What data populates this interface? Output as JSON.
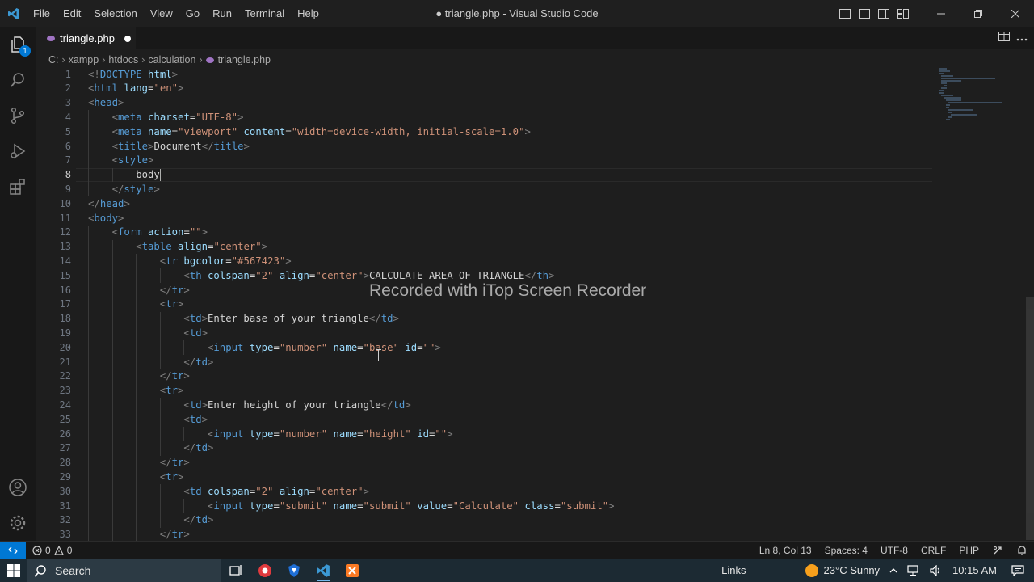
{
  "window": {
    "title": "● triangle.php - Visual Studio Code",
    "menu": [
      "File",
      "Edit",
      "Selection",
      "View",
      "Go",
      "Run",
      "Terminal",
      "Help"
    ]
  },
  "activity_bar": {
    "explorer_badge": "1"
  },
  "tab": {
    "label": "triangle.php"
  },
  "breadcrumb": [
    "C:",
    "xampp",
    "htdocs",
    "calculation",
    "triangle.php"
  ],
  "editor": {
    "current_line": 8,
    "lines": [
      {
        "n": "1",
        "indent": 0,
        "t": [
          [
            "tb",
            "<!"
          ],
          [
            "tn",
            "DOCTYPE"
          ],
          [
            "tx",
            " "
          ],
          [
            "an",
            "html"
          ],
          [
            "tb",
            ">"
          ]
        ]
      },
      {
        "n": "2",
        "indent": 0,
        "t": [
          [
            "tb",
            "<"
          ],
          [
            "tn",
            "html"
          ],
          [
            "tx",
            " "
          ],
          [
            "an",
            "lang"
          ],
          [
            "tx",
            "="
          ],
          [
            "av",
            "\"en\""
          ],
          [
            "tb",
            ">"
          ]
        ]
      },
      {
        "n": "3",
        "indent": 0,
        "t": [
          [
            "tb",
            "<"
          ],
          [
            "tn",
            "head"
          ],
          [
            "tb",
            ">"
          ]
        ]
      },
      {
        "n": "4",
        "indent": 1,
        "t": [
          [
            "tb",
            "<"
          ],
          [
            "tn",
            "meta"
          ],
          [
            "tx",
            " "
          ],
          [
            "an",
            "charset"
          ],
          [
            "tx",
            "="
          ],
          [
            "av",
            "\"UTF-8\""
          ],
          [
            "tb",
            ">"
          ]
        ]
      },
      {
        "n": "5",
        "indent": 1,
        "t": [
          [
            "tb",
            "<"
          ],
          [
            "tn",
            "meta"
          ],
          [
            "tx",
            " "
          ],
          [
            "an",
            "name"
          ],
          [
            "tx",
            "="
          ],
          [
            "av",
            "\"viewport\""
          ],
          [
            "tx",
            " "
          ],
          [
            "an",
            "content"
          ],
          [
            "tx",
            "="
          ],
          [
            "av",
            "\"width=device-width, initial-scale=1.0\""
          ],
          [
            "tb",
            ">"
          ]
        ]
      },
      {
        "n": "6",
        "indent": 1,
        "t": [
          [
            "tb",
            "<"
          ],
          [
            "tn",
            "title"
          ],
          [
            "tb",
            ">"
          ],
          [
            "tx",
            "Document"
          ],
          [
            "tb",
            "</"
          ],
          [
            "tn",
            "title"
          ],
          [
            "tb",
            ">"
          ]
        ]
      },
      {
        "n": "7",
        "indent": 1,
        "t": [
          [
            "tb",
            "<"
          ],
          [
            "tn",
            "style"
          ],
          [
            "tb",
            ">"
          ]
        ]
      },
      {
        "n": "8",
        "indent": 2,
        "t": [
          [
            "tx",
            "body"
          ]
        ],
        "cursor": true
      },
      {
        "n": "9",
        "indent": 1,
        "t": [
          [
            "tb",
            "</"
          ],
          [
            "tn",
            "style"
          ],
          [
            "tb",
            ">"
          ]
        ]
      },
      {
        "n": "10",
        "indent": 0,
        "t": [
          [
            "tb",
            "</"
          ],
          [
            "tn",
            "head"
          ],
          [
            "tb",
            ">"
          ]
        ]
      },
      {
        "n": "11",
        "indent": 0,
        "t": [
          [
            "tb",
            "<"
          ],
          [
            "tn",
            "body"
          ],
          [
            "tb",
            ">"
          ]
        ]
      },
      {
        "n": "12",
        "indent": 1,
        "t": [
          [
            "tb",
            "<"
          ],
          [
            "tn",
            "form"
          ],
          [
            "tx",
            " "
          ],
          [
            "an",
            "action"
          ],
          [
            "tx",
            "="
          ],
          [
            "av",
            "\"\""
          ],
          [
            "tb",
            ">"
          ]
        ]
      },
      {
        "n": "13",
        "indent": 2,
        "t": [
          [
            "tb",
            "<"
          ],
          [
            "tn",
            "table"
          ],
          [
            "tx",
            " "
          ],
          [
            "an",
            "align"
          ],
          [
            "tx",
            "="
          ],
          [
            "av",
            "\"center\""
          ],
          [
            "tb",
            ">"
          ]
        ]
      },
      {
        "n": "14",
        "indent": 3,
        "t": [
          [
            "tb",
            "<"
          ],
          [
            "tn",
            "tr"
          ],
          [
            "tx",
            " "
          ],
          [
            "an",
            "bgcolor"
          ],
          [
            "tx",
            "="
          ],
          [
            "av",
            "\"#567423\""
          ],
          [
            "tb",
            ">"
          ]
        ]
      },
      {
        "n": "15",
        "indent": 4,
        "t": [
          [
            "tb",
            "<"
          ],
          [
            "tn",
            "th"
          ],
          [
            "tx",
            " "
          ],
          [
            "an",
            "colspan"
          ],
          [
            "tx",
            "="
          ],
          [
            "av",
            "\"2\""
          ],
          [
            "tx",
            " "
          ],
          [
            "an",
            "align"
          ],
          [
            "tx",
            "="
          ],
          [
            "av",
            "\"center\""
          ],
          [
            "tb",
            ">"
          ],
          [
            "tx",
            "CALCULATE AREA OF TRIANGLE"
          ],
          [
            "tb",
            "</"
          ],
          [
            "tn",
            "th"
          ],
          [
            "tb",
            ">"
          ]
        ]
      },
      {
        "n": "16",
        "indent": 3,
        "t": [
          [
            "tb",
            "</"
          ],
          [
            "tn",
            "tr"
          ],
          [
            "tb",
            ">"
          ]
        ]
      },
      {
        "n": "17",
        "indent": 3,
        "t": [
          [
            "tb",
            "<"
          ],
          [
            "tn",
            "tr"
          ],
          [
            "tb",
            ">"
          ]
        ]
      },
      {
        "n": "18",
        "indent": 4,
        "t": [
          [
            "tb",
            "<"
          ],
          [
            "tn",
            "td"
          ],
          [
            "tb",
            ">"
          ],
          [
            "tx",
            "Enter base of your triangle"
          ],
          [
            "tb",
            "</"
          ],
          [
            "tn",
            "td"
          ],
          [
            "tb",
            ">"
          ]
        ]
      },
      {
        "n": "19",
        "indent": 4,
        "t": [
          [
            "tb",
            "<"
          ],
          [
            "tn",
            "td"
          ],
          [
            "tb",
            ">"
          ]
        ]
      },
      {
        "n": "20",
        "indent": 5,
        "t": [
          [
            "tb",
            "<"
          ],
          [
            "tn",
            "input"
          ],
          [
            "tx",
            " "
          ],
          [
            "an",
            "type"
          ],
          [
            "tx",
            "="
          ],
          [
            "av",
            "\"number\""
          ],
          [
            "tx",
            " "
          ],
          [
            "an",
            "name"
          ],
          [
            "tx",
            "="
          ],
          [
            "av",
            "\"base\""
          ],
          [
            "tx",
            " "
          ],
          [
            "an",
            "id"
          ],
          [
            "tx",
            "="
          ],
          [
            "av",
            "\"\""
          ],
          [
            "tb",
            ">"
          ]
        ]
      },
      {
        "n": "21",
        "indent": 4,
        "t": [
          [
            "tb",
            "</"
          ],
          [
            "tn",
            "td"
          ],
          [
            "tb",
            ">"
          ]
        ]
      },
      {
        "n": "22",
        "indent": 3,
        "t": [
          [
            "tb",
            "</"
          ],
          [
            "tn",
            "tr"
          ],
          [
            "tb",
            ">"
          ]
        ]
      },
      {
        "n": "23",
        "indent": 3,
        "t": [
          [
            "tb",
            "<"
          ],
          [
            "tn",
            "tr"
          ],
          [
            "tb",
            ">"
          ]
        ]
      },
      {
        "n": "24",
        "indent": 4,
        "t": [
          [
            "tb",
            "<"
          ],
          [
            "tn",
            "td"
          ],
          [
            "tb",
            ">"
          ],
          [
            "tx",
            "Enter height of your triangle"
          ],
          [
            "tb",
            "</"
          ],
          [
            "tn",
            "td"
          ],
          [
            "tb",
            ">"
          ]
        ]
      },
      {
        "n": "25",
        "indent": 4,
        "t": [
          [
            "tb",
            "<"
          ],
          [
            "tn",
            "td"
          ],
          [
            "tb",
            ">"
          ]
        ]
      },
      {
        "n": "26",
        "indent": 5,
        "t": [
          [
            "tb",
            "<"
          ],
          [
            "tn",
            "input"
          ],
          [
            "tx",
            " "
          ],
          [
            "an",
            "type"
          ],
          [
            "tx",
            "="
          ],
          [
            "av",
            "\"number\""
          ],
          [
            "tx",
            " "
          ],
          [
            "an",
            "name"
          ],
          [
            "tx",
            "="
          ],
          [
            "av",
            "\"height\""
          ],
          [
            "tx",
            " "
          ],
          [
            "an",
            "id"
          ],
          [
            "tx",
            "="
          ],
          [
            "av",
            "\"\""
          ],
          [
            "tb",
            ">"
          ]
        ]
      },
      {
        "n": "27",
        "indent": 4,
        "t": [
          [
            "tb",
            "</"
          ],
          [
            "tn",
            "td"
          ],
          [
            "tb",
            ">"
          ]
        ]
      },
      {
        "n": "28",
        "indent": 3,
        "t": [
          [
            "tb",
            "</"
          ],
          [
            "tn",
            "tr"
          ],
          [
            "tb",
            ">"
          ]
        ]
      },
      {
        "n": "29",
        "indent": 3,
        "t": [
          [
            "tb",
            "<"
          ],
          [
            "tn",
            "tr"
          ],
          [
            "tb",
            ">"
          ]
        ]
      },
      {
        "n": "30",
        "indent": 4,
        "t": [
          [
            "tb",
            "<"
          ],
          [
            "tn",
            "td"
          ],
          [
            "tx",
            " "
          ],
          [
            "an",
            "colspan"
          ],
          [
            "tx",
            "="
          ],
          [
            "av",
            "\"2\""
          ],
          [
            "tx",
            " "
          ],
          [
            "an",
            "align"
          ],
          [
            "tx",
            "="
          ],
          [
            "av",
            "\"center\""
          ],
          [
            "tb",
            ">"
          ]
        ]
      },
      {
        "n": "31",
        "indent": 5,
        "t": [
          [
            "tb",
            "<"
          ],
          [
            "tn",
            "input"
          ],
          [
            "tx",
            " "
          ],
          [
            "an",
            "type"
          ],
          [
            "tx",
            "="
          ],
          [
            "av",
            "\"submit\""
          ],
          [
            "tx",
            " "
          ],
          [
            "an",
            "name"
          ],
          [
            "tx",
            "="
          ],
          [
            "av",
            "\"submit\""
          ],
          [
            "tx",
            " "
          ],
          [
            "an",
            "value"
          ],
          [
            "tx",
            "="
          ],
          [
            "av",
            "\"Calculate\""
          ],
          [
            "tx",
            " "
          ],
          [
            "an",
            "class"
          ],
          [
            "tx",
            "="
          ],
          [
            "av",
            "\"submit\""
          ],
          [
            "tb",
            ">"
          ]
        ]
      },
      {
        "n": "32",
        "indent": 4,
        "t": [
          [
            "tb",
            "</"
          ],
          [
            "tn",
            "td"
          ],
          [
            "tb",
            ">"
          ]
        ]
      },
      {
        "n": "33",
        "indent": 3,
        "t": [
          [
            "tb",
            "</"
          ],
          [
            "tn",
            "tr"
          ],
          [
            "tb",
            ">"
          ]
        ]
      }
    ]
  },
  "watermark": "Recorded with iTop Screen Recorder",
  "status_bar": {
    "errors": "0",
    "warnings": "0",
    "position": "Ln 8, Col 13",
    "spaces": "Spaces: 4",
    "encoding": "UTF-8",
    "eol": "CRLF",
    "language": "PHP"
  },
  "taskbar": {
    "search_label": "Search",
    "links": "Links",
    "weather": "23°C  Sunny",
    "clock": "10:15 AM",
    "active_app": "vscode-icon"
  }
}
